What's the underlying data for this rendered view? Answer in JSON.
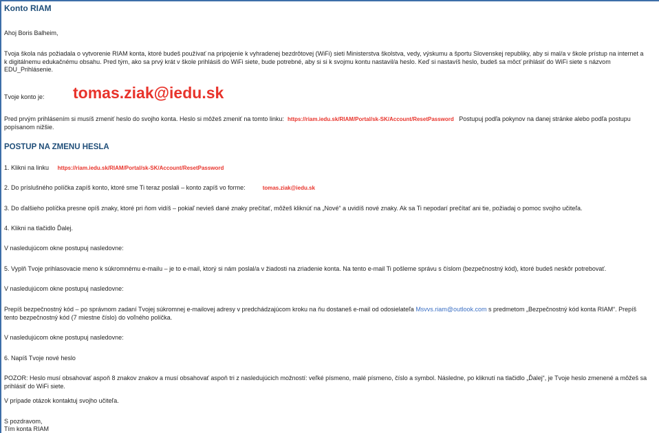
{
  "title": "Konto RIAM",
  "greeting": "Ahoj Boris Balheim,",
  "intro": "Tvoja škola nás požiadala o vytvorenie RIAM konta, ktoré budeš používať na pripojenie k vyhradenej bezdrôtovej (WiFi) sieti Ministerstva školstva, vedy, výskumu a športu Slovenskej republiky, aby si mal/a v škole prístup na internet a k digitálnemu edukačnému obsahu. Pred tým, ako sa prvý krát v škole prihlásiš do WiFi siete, bude potrebné, aby si si k svojmu kontu nastavil/a heslo. Keď si nastavíš heslo, budeš sa môcť prihlásiť do WiFi siete s názvom EDU_Prihlásenie.",
  "account_label": "Tvoje konto je:",
  "account": "tomas.ziak@iedu.sk",
  "change_intro": "Pred prvým prihlásením si musíš zmeniť heslo do svojho konta. Heslo si môžeš zmeniť na tomto linku:",
  "reset_url": "https://riam.iedu.sk/RIAM/Portal/sk-SK/Account/ResetPassword",
  "change_after": "Postupuj podľa pokynov na danej stránke alebo podľa postupu popísanom nižšie.",
  "section_heading": "POSTUP NA ZMENU HESLA",
  "step1_label": "1. Klikni na linku",
  "step2_text": "2. Do príslušného políčka zapíš konto, ktoré sme Ti teraz poslali – konto zapíš vo forme:",
  "step3_text": "3. Do ďalšieho políčka presne opíš znaky, ktoré pri ňom vidíš – pokiaľ nevieš dané znaky prečítať, môžeš kliknúť na „Nové“ a uvidíš nové znaky. Ak sa Ti nepodarí prečítať ani tie, požiadaj o pomoc svojho učiteľa.",
  "step4_text": "4. Klikni na tlačidlo Ďalej.",
  "next_window": "V nasledujúcom okne postupuj nasledovne:",
  "step5_text": "5. Vyplň Tvoje prihlasovacie meno k súkromnému e-mailu – je to e-mail, ktorý si nám poslal/a v žiadosti na zriadenie konta. Na tento e-mail Ti pošleme správu s číslom (bezpečnostný kód), ktoré budeš neskôr potrebovať.",
  "code_before": "Prepíš bezpečnostný kód – po správnom zadaní Tvojej súkromnej e-mailovej adresy v predchádzajúcom kroku na ňu dostaneš e-mail od odosielateľa",
  "sender_email": "Msvvs.riam@outlook.com",
  "code_after": "s predmetom „Bezpečnostný kód konta RIAM“. Prepíš tento bezpečnostný kód (7 miestne číslo) do voľného políčka.",
  "step6_text": "6. Napíš Tvoje nové heslo",
  "warning": "POZOR: Heslo musí obsahovať aspoň 8 znakov znakov a musí obsahovať aspoň tri z nasledujúcich možností: veľké písmeno, malé písmeno, číslo a symbol. Následne, po kliknutí na tlačidlo „Ďalej“, je Tvoje heslo zmenené a môžeš sa prihlásiť do WiFi siete.",
  "contact": "V prípade otázok kontaktuj svojho učiteľa.",
  "closing": "S pozdravom,",
  "signature": "Tím konta RIAM"
}
